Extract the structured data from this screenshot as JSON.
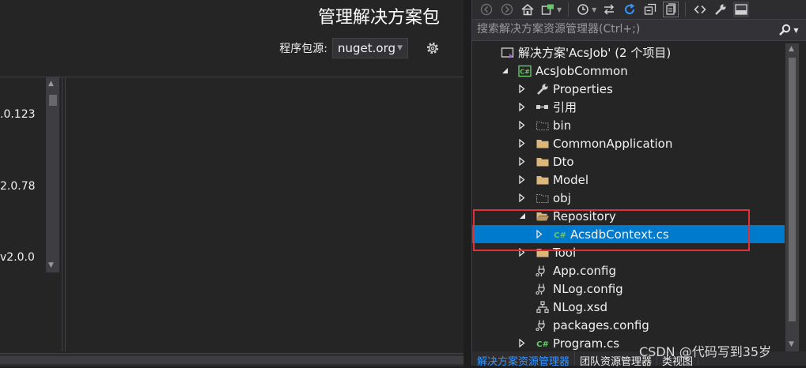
{
  "nuget": {
    "title": "管理解决方案包",
    "source_label": "程序包源:",
    "source_value": "nuget.org",
    "settings_icon": "gear-icon",
    "versions": [
      ".0.123",
      "2.0.78",
      "v2.0.0"
    ]
  },
  "solution_explorer": {
    "search_placeholder": "搜索解决方案资源管理器(Ctrl+;)",
    "toolbar_icons": [
      "back-icon",
      "forward-icon",
      "home-icon",
      "switch-views-icon",
      "history-icon",
      "sync-icon",
      "refresh-icon",
      "collapse-all-icon",
      "show-all-files-icon",
      "code-view-icon",
      "properties-icon",
      "preview-icon"
    ],
    "tree": [
      {
        "label": "解决方案'AcsJob' (2 个项目)",
        "depth": 0,
        "expander": "none",
        "icon": "solution-icon"
      },
      {
        "label": "AcsJobCommon",
        "depth": 1,
        "expander": "expanded",
        "icon": "csharp-project-icon"
      },
      {
        "label": "Properties",
        "depth": 2,
        "expander": "collapsed",
        "icon": "wrench-icon"
      },
      {
        "label": "引用",
        "depth": 2,
        "expander": "collapsed",
        "icon": "references-icon"
      },
      {
        "label": "bin",
        "depth": 2,
        "expander": "collapsed",
        "icon": "hidden-folder-icon"
      },
      {
        "label": "CommonApplication",
        "depth": 2,
        "expander": "collapsed",
        "icon": "folder-icon"
      },
      {
        "label": "Dto",
        "depth": 2,
        "expander": "collapsed",
        "icon": "folder-icon"
      },
      {
        "label": "Model",
        "depth": 2,
        "expander": "collapsed",
        "icon": "folder-icon"
      },
      {
        "label": "obj",
        "depth": 2,
        "expander": "collapsed",
        "icon": "hidden-folder-icon"
      },
      {
        "label": "Repository",
        "depth": 2,
        "expander": "expanded",
        "icon": "open-folder-icon"
      },
      {
        "label": "AcsdbContext.cs",
        "depth": 3,
        "expander": "collapsed",
        "icon": "csharp-file-icon",
        "selected": true
      },
      {
        "label": "Tool",
        "depth": 2,
        "expander": "collapsed",
        "icon": "folder-icon"
      },
      {
        "label": "App.config",
        "depth": 2,
        "expander": "none",
        "icon": "config-file-icon"
      },
      {
        "label": "NLog.config",
        "depth": 2,
        "expander": "none",
        "icon": "config-file-icon"
      },
      {
        "label": "NLog.xsd",
        "depth": 2,
        "expander": "none",
        "icon": "xsd-file-icon"
      },
      {
        "label": "packages.config",
        "depth": 2,
        "expander": "none",
        "icon": "config-file-icon"
      },
      {
        "label": "Program.cs",
        "depth": 2,
        "expander": "collapsed",
        "icon": "csharp-file-icon"
      }
    ],
    "tabs": [
      {
        "label": "解决方案资源管理器",
        "active": true
      },
      {
        "label": "团队资源管理器",
        "active": false
      },
      {
        "label": "类视图",
        "active": false
      }
    ]
  },
  "watermark": "CSDN @代码写到35岁",
  "colors": {
    "selection": "#007acc",
    "highlight_box": "#e0313b",
    "folder": "#dcb67a",
    "csharp": "#68c76a"
  }
}
